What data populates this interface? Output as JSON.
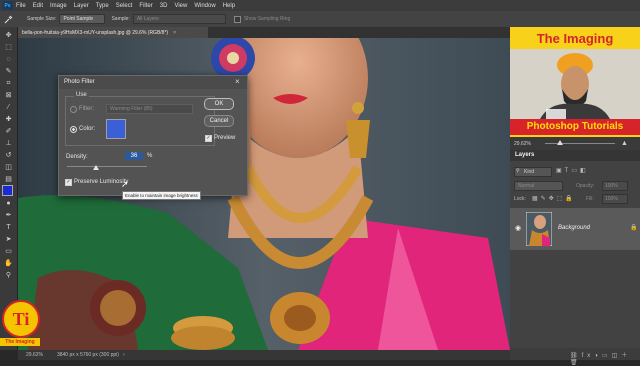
{
  "menu": {
    "items": [
      "File",
      "Edit",
      "Image",
      "Layer",
      "Type",
      "Select",
      "Filter",
      "3D",
      "View",
      "Window",
      "Help"
    ]
  },
  "options_bar": {
    "sample_size_label": "Sample Size:",
    "sample_size_value": "Point Sample",
    "sample_label": "Sample:",
    "sample_value": "All Layers",
    "show_ring_label": "Show Sampling Ring"
  },
  "document": {
    "tab_title": "bella-pon-fruitsia-y9HsMX3-mUY-unsplash.jpg @ 29.6% (RGB/8*)",
    "close": "×"
  },
  "status": {
    "zoom": "29.62%",
    "size": "3840 px x 5760 px (300 ppi)"
  },
  "dialog": {
    "title": "Photo Filter",
    "use_label": "Use",
    "filter_label": "Filter:",
    "filter_value": "Warming Filter (85)",
    "color_label": "Color:",
    "color_swatch": "#3a5fd6",
    "density_label": "Density:",
    "density_value": "36",
    "density_unit": "%",
    "density_fraction": 0.36,
    "preserve_label": "Preserve Luminosity",
    "tooltip": "Enable to maintain image brightness",
    "ok_label": "OK",
    "cancel_label": "Cancel",
    "preview_label": "Preview"
  },
  "thumbnail": {
    "title": "The Imaging",
    "subtitle": "Photoshop Tutorials"
  },
  "navigator": {
    "zoom": "29.62%"
  },
  "layers": {
    "tab_label": "Layers",
    "kind_label": "Kind",
    "mode": "Normal",
    "opacity_label": "Opacity:",
    "opacity_value": "100%",
    "lock_label": "Lock:",
    "fill_label": "Fill:",
    "fill_value": "100%",
    "layer_name": "Background"
  },
  "logo": {
    "text": "Ti",
    "caption": "The Imaging"
  },
  "colors": {
    "foreground": "#1a2bd6",
    "background": "#000000",
    "accent_blue": "#2f78d8",
    "thumbnail_yellow": "#f7d11a",
    "banner_red": "#d7232a"
  }
}
